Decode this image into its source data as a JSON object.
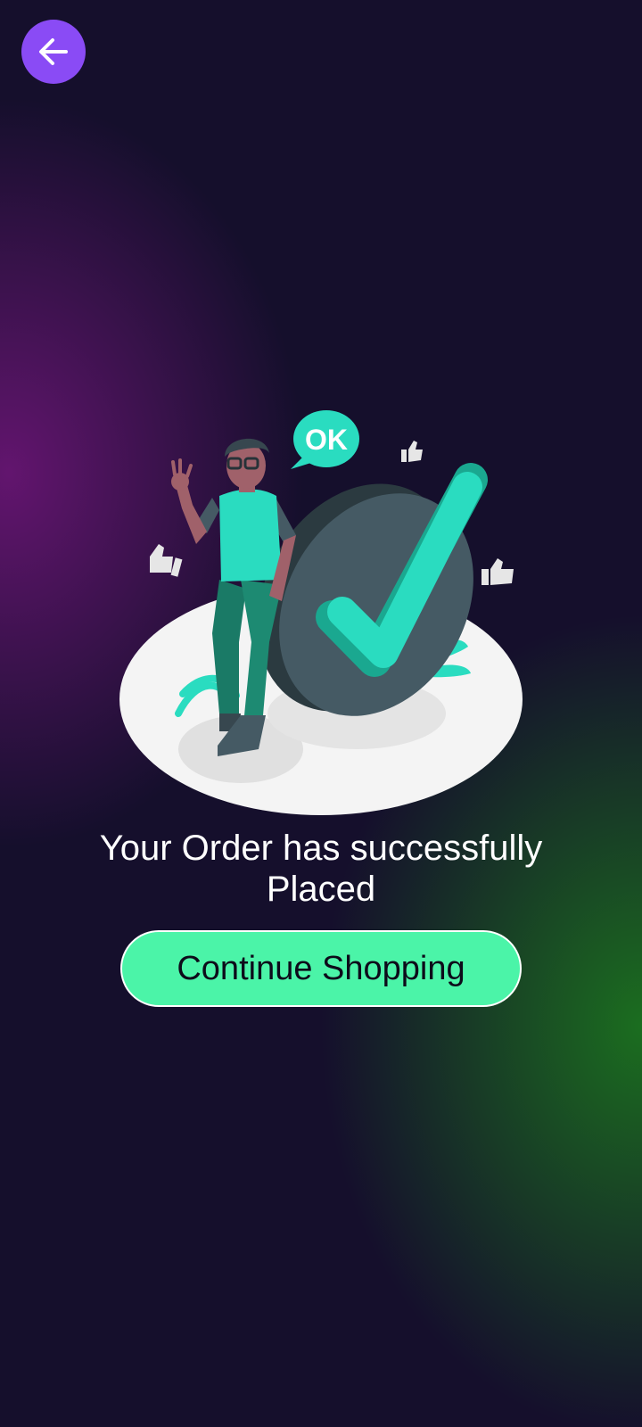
{
  "header": {
    "back_icon": "arrow-left-icon"
  },
  "illustration": {
    "speech_bubble_text": "OK"
  },
  "message": {
    "line1": "Your Order has successfully",
    "line2": "Placed"
  },
  "actions": {
    "continue_label": "Continue Shopping"
  },
  "colors": {
    "background": "#150f2c",
    "back_button": "#8a4bf5",
    "accent_teal": "#2adcc0",
    "continue_button": "#4bf4a8"
  }
}
